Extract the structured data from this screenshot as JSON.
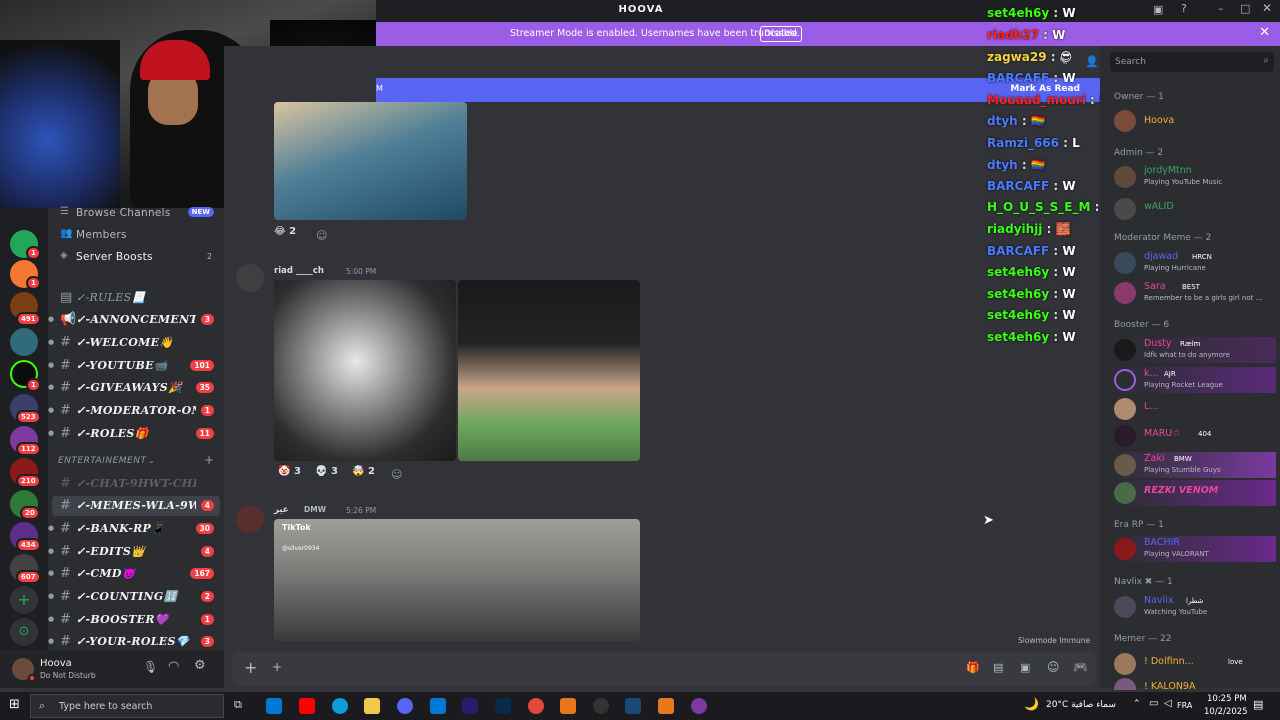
{
  "window": {
    "title": "HOOVA"
  },
  "banner": {
    "text": "Streamer Mode is enabled. Usernames have been truncated.",
    "button": "Disable"
  },
  "mark_as_read": "Mark As Read",
  "servers": {
    "badges": [
      "1",
      "1",
      "1",
      "491",
      "523",
      "112",
      "210",
      "20",
      "434",
      "607"
    ]
  },
  "channels": {
    "browse": "Browse Channels",
    "browse_badge": "NEW",
    "members": "Members",
    "boosts": "Server Boosts",
    "boosts_count": "2",
    "list": [
      {
        "name": "✓-RULES📃",
        "count": ""
      },
      {
        "name": "✓-ANNONCEMENTS...",
        "count": "3"
      },
      {
        "name": "✓-WELCOME👋",
        "count": ""
      },
      {
        "name": "✓-YOUTUBE📹",
        "count": "101"
      },
      {
        "name": "✓-GIVEAWAYS🎉",
        "count": "35"
      },
      {
        "name": "✓-MODERATOR-ON...",
        "count": "1"
      },
      {
        "name": "✓-ROLES🎁",
        "count": "11"
      }
    ],
    "category": "ENTERTAINEMENT",
    "list2": [
      {
        "name": "✓-CHAT-9HWT-CHRGUI",
        "count": ""
      },
      {
        "name": "✓-MEMES-WLA-9W...",
        "count": "4"
      },
      {
        "name": "✓-BANK-RP📱",
        "count": "30"
      },
      {
        "name": "✓-EDITS👑",
        "count": "4"
      },
      {
        "name": "✓-CMD😈",
        "count": "167"
      },
      {
        "name": "✓-COUNTING🔢",
        "count": "2"
      },
      {
        "name": "✓-BOOSTER💜",
        "count": "1"
      },
      {
        "name": "✓-YOUR-ROLES💎",
        "count": "3"
      }
    ]
  },
  "user": {
    "name": "Hoova",
    "status": "Do Not Disturb"
  },
  "messages": [
    {
      "reactions": [
        {
          "emoji": "😂",
          "count": "2"
        }
      ]
    },
    {
      "author": "riad ____ch",
      "time": "5:00 PM",
      "reactions": [
        {
          "emoji": "🤡",
          "count": "3"
        },
        {
          "emoji": "💀",
          "count": "3"
        },
        {
          "emoji": "🤯",
          "count": "2"
        }
      ]
    },
    {
      "author": "عير",
      "tag": "DMW",
      "time": "5:26 PM",
      "video_label": "TikTok",
      "video_user": "@silver0934"
    }
  ],
  "slowmode": "Slowmode Immune",
  "overlay": [
    {
      "user": "set4eh6y",
      "msg": "W",
      "color": "#39ff14"
    },
    {
      "user": "riadh27",
      "msg": "W",
      "color": "#ff2020"
    },
    {
      "user": "zagwa29",
      "msg": "😎",
      "color": "#f5d442"
    },
    {
      "user": "BARCAFF",
      "msg": "W",
      "color": "#4a7bff"
    },
    {
      "user": "Mouaad_mouri",
      "msg": "L",
      "color": "#ff2020"
    },
    {
      "user": "dtyh",
      "msg": "🏳️‍🌈",
      "color": "#4a7bff"
    },
    {
      "user": "Ramzi_666",
      "msg": "L",
      "color": "#4a7bff"
    },
    {
      "user": "dtyh",
      "msg": "🏳️‍🌈",
      "color": "#4a7bff"
    },
    {
      "user": "BARCAFF",
      "msg": "W",
      "color": "#4a7bff"
    },
    {
      "user": "H_O_U_S_S_E_M",
      "msg": "*****",
      "color": "#39ff14"
    },
    {
      "user": "riadyihjj",
      "msg": "🧱",
      "color": "#39ff14"
    },
    {
      "user": "BARCAFF",
      "msg": "W",
      "color": "#4a7bff"
    },
    {
      "user": "set4eh6y",
      "msg": "W",
      "color": "#39ff14"
    },
    {
      "user": "set4eh6y",
      "msg": "W",
      "color": "#39ff14"
    },
    {
      "user": "set4eh6y",
      "msg": "W",
      "color": "#39ff14"
    },
    {
      "user": "set4eh6y",
      "msg": "W",
      "color": "#39ff14"
    }
  ],
  "members": {
    "search_placeholder": "Search",
    "groups": [
      {
        "title": "Owner — 1",
        "items": [
          {
            "name": "Hoova",
            "status": "",
            "color": "#f0b232"
          }
        ]
      },
      {
        "title": "Admin — 2",
        "items": [
          {
            "name": "jordyMtnn",
            "status": "Playing YouTube Music",
            "color": "#3ba55d"
          },
          {
            "name": "wALID",
            "status": "",
            "color": "#3ba55d"
          }
        ]
      },
      {
        "title": "Moderator Meme — 2",
        "items": [
          {
            "name": "djawad",
            "tag": "HRCN",
            "status": "Playing Hurricane",
            "color": "#5865f2"
          },
          {
            "name": "Sara",
            "tag": "BEST",
            "status": "Remember to be a girls girl not ...",
            "color": "#eb459e"
          }
        ]
      },
      {
        "title": "Booster — 6",
        "items": [
          {
            "name": "Dusty",
            "tag": "Rælm",
            "status": "Idfk what to do anymore",
            "color": "#eb459e"
          },
          {
            "name": "k...",
            "tag": "AJR",
            "status": "Playing Rocket League",
            "color": "#eb459e"
          },
          {
            "name": "L...",
            "status": "",
            "color": "#eb459e"
          },
          {
            "name": "MARU☆",
            "tag": "404",
            "status": "",
            "color": "#eb459e"
          },
          {
            "name": "Zaki",
            "tag": "BMW",
            "status": "Playing Stumble Guys",
            "color": "#eb459e"
          },
          {
            "name": "REZKI VENOM",
            "status": "",
            "color": "#eb459e"
          }
        ]
      },
      {
        "title": "Era RP — 1",
        "items": [
          {
            "name": "BACHIR",
            "status": "Playing VALORANT",
            "color": "#5865f2"
          }
        ]
      },
      {
        "title": "Navlix ✖ — 1",
        "items": [
          {
            "name": "Navlix",
            "tag": "شطرا",
            "status": "Watching YouTube",
            "color": "#5865f2"
          }
        ]
      },
      {
        "title": "Memer — 22",
        "items": [
          {
            "name": "! Dolfinn...",
            "tag": "love",
            "status": "",
            "color": "#f0b232"
          },
          {
            "name": "! KALON9A",
            "status": "",
            "color": "#f0b232"
          }
        ]
      }
    ]
  },
  "taskbar": {
    "search_placeholder": "Type here to search",
    "weather": "20°C  سماء صافية",
    "lang": "FRA",
    "time": "10:25 PM",
    "date": "10/2/2025"
  }
}
